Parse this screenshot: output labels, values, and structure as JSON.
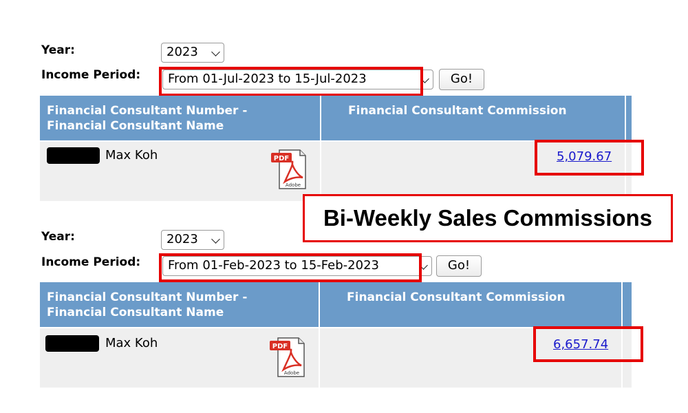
{
  "sections": [
    {
      "year_label": "Year:",
      "year_value": "2023",
      "period_label": "Income Period:",
      "period_value": "From 01-Jul-2023 to 15-Jul-2023",
      "go_label": "Go!",
      "table": {
        "col1_header_line1": "Financial Consultant Number -",
        "col1_header_line2": "Financial Consultant Name",
        "col2_header": "Financial Consultant Commission",
        "consultant_name": "Max Koh",
        "commission": "5,079.67"
      }
    },
    {
      "year_label": "Year:",
      "year_value": "2023",
      "period_label": "Income Period:",
      "period_value": "From 01-Feb-2023 to 15-Feb-2023",
      "go_label": "Go!",
      "table": {
        "col1_header_line1": "Financial Consultant Number -",
        "col1_header_line2": "Financial Consultant Name",
        "col2_header": "Financial Consultant Commission",
        "consultant_name": "Max Koh",
        "commission": "6,657.74"
      }
    }
  ],
  "callout": "Bi-Weekly Sales Commissions",
  "pdf_icon": {
    "icon": "pdf-adobe-icon",
    "badge_text": "PDF",
    "brand_text": "Adobe"
  },
  "colors": {
    "header_bg": "#6b9bc9",
    "row_bg": "#efefef",
    "highlight": "#e60000",
    "link": "#1a1acc"
  }
}
